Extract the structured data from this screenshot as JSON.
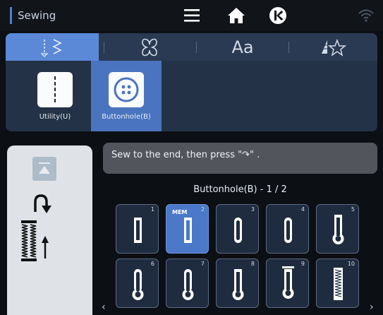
{
  "header": {
    "title": "Sewing",
    "icons": [
      "menu-icon",
      "home-icon",
      "k-circle-icon",
      "wifi-icon"
    ]
  },
  "tabs": [
    {
      "name": "utility-stitch-tab",
      "label": "",
      "active": true
    },
    {
      "name": "decorative-tab",
      "label": "",
      "active": false
    },
    {
      "name": "text-tab",
      "label": "Aa",
      "active": false
    },
    {
      "name": "favorites-tab",
      "label": "",
      "active": false
    }
  ],
  "categories": [
    {
      "label": "Utility(U)",
      "active": false
    },
    {
      "label": "Buttonhole(B)",
      "active": true
    }
  ],
  "message": "Sew to the end, then press \"↷\" .",
  "grid": {
    "title": "Buttonhole(B) - 1 / 2",
    "stitches": [
      {
        "num": "1",
        "selected": false,
        "badge": ""
      },
      {
        "num": "2",
        "selected": true,
        "badge": "MEM"
      },
      {
        "num": "3",
        "selected": false,
        "badge": ""
      },
      {
        "num": "4",
        "selected": false,
        "badge": ""
      },
      {
        "num": "5",
        "selected": false,
        "badge": ""
      },
      {
        "num": "6",
        "selected": false,
        "badge": ""
      },
      {
        "num": "7",
        "selected": false,
        "badge": ""
      },
      {
        "num": "8",
        "selected": false,
        "badge": ""
      },
      {
        "num": "9",
        "selected": false,
        "badge": ""
      },
      {
        "num": "10",
        "selected": false,
        "badge": ""
      }
    ]
  },
  "nav": {
    "prev": "‹",
    "next": "›"
  },
  "colors": {
    "accent": "#5b89d8",
    "selected": "#4b78c8",
    "panel": "#233246"
  }
}
